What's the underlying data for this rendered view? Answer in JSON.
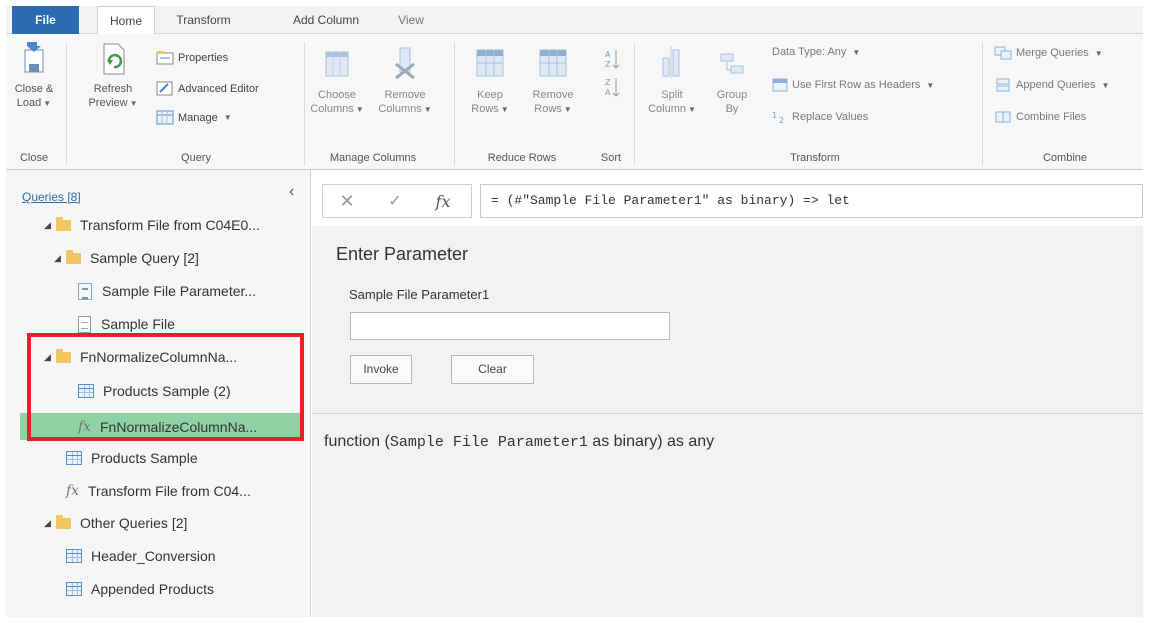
{
  "tabs": {
    "file": "File",
    "home": "Home",
    "transform": "Transform",
    "add_column": "Add Column",
    "view": "View"
  },
  "ribbon": {
    "close": {
      "close_load": "Close &",
      "close_load_2": "Load",
      "group": "Close"
    },
    "query": {
      "refresh": "Refresh",
      "preview": "Preview",
      "properties": "Properties",
      "advanced_editor": "Advanced Editor",
      "manage": "Manage",
      "group": "Query"
    },
    "manage_columns": {
      "choose": "Choose",
      "choose_2": "Columns",
      "remove": "Remove",
      "remove_2": "Columns",
      "group": "Manage Columns"
    },
    "reduce_rows": {
      "keep": "Keep",
      "keep_2": "Rows",
      "remove": "Remove",
      "remove_2": "Rows",
      "group": "Reduce Rows"
    },
    "sort": {
      "group": "Sort"
    },
    "transform": {
      "split": "Split",
      "split_2": "Column",
      "group_by": "Group",
      "group_by_2": "By",
      "data_type": "Data Type: Any",
      "first_row_headers": "Use First Row as Headers",
      "replace_values": "Replace Values",
      "group": "Transform"
    },
    "combine": {
      "merge_queries": "Merge Queries",
      "append_queries": "Append Queries",
      "combine_files": "Combine Files",
      "group": "Combine"
    }
  },
  "queries": {
    "header": "Queries [8]",
    "items": [
      {
        "label": "Transform File from C04E0...",
        "type": "folder"
      },
      {
        "label": "Sample Query [2]",
        "type": "folder"
      },
      {
        "label": "Sample File Parameter...",
        "type": "parameter"
      },
      {
        "label": "Sample File",
        "type": "document"
      },
      {
        "label": "FnNormalizeColumnNa...",
        "type": "folder"
      },
      {
        "label": "Products Sample (2)",
        "type": "table"
      },
      {
        "label": "FnNormalizeColumnNa...",
        "type": "function",
        "selected": true
      },
      {
        "label": "Products Sample",
        "type": "table"
      },
      {
        "label": "Transform File from C04...",
        "type": "function"
      },
      {
        "label": "Other Queries [2]",
        "type": "folder"
      },
      {
        "label": "Header_Conversion",
        "type": "table"
      },
      {
        "label": "Appended Products",
        "type": "table"
      }
    ]
  },
  "formula_bar": {
    "cancel_glyph": "✕",
    "commit_glyph": "✓",
    "fx": "fx",
    "formula": "= (#\"Sample File Parameter1\" as binary) => let"
  },
  "main": {
    "title": "Enter Parameter",
    "param_label": "Sample File Parameter1",
    "param_value": "",
    "invoke": "Invoke",
    "clear": "Clear",
    "signature_prefix": "function (",
    "signature_param": "Sample File Parameter1",
    "signature_suffix": " as binary) as any"
  },
  "colors": {
    "file_tab": "#2b6cb0",
    "selected_item": "#8fd3a4",
    "highlight_box": "#e8202a",
    "folder": "#f0c75e"
  }
}
